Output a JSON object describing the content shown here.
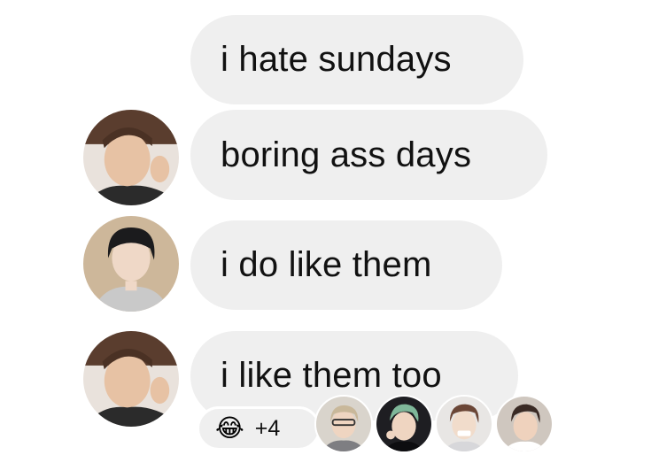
{
  "messages": [
    {
      "text": "i hate sundays"
    },
    {
      "text": "boring ass days"
    },
    {
      "text": "i do like them"
    },
    {
      "text": "i like them too"
    }
  ],
  "avatars": [
    {
      "icon": "avatar-photo-user-a"
    },
    {
      "icon": "avatar-photo-user-b"
    },
    {
      "icon": "avatar-photo-user-a"
    }
  ],
  "reactions": {
    "emoji": "😂",
    "emoji_name": "tears-of-joy-icon",
    "count": "+4"
  },
  "seen_by": [
    {
      "icon": "seen-avatar-1"
    },
    {
      "icon": "seen-avatar-2"
    },
    {
      "icon": "seen-avatar-3"
    },
    {
      "icon": "seen-avatar-4"
    }
  ],
  "colors": {
    "bubble": "#efefef",
    "text": "#111111",
    "background": "#ffffff"
  }
}
